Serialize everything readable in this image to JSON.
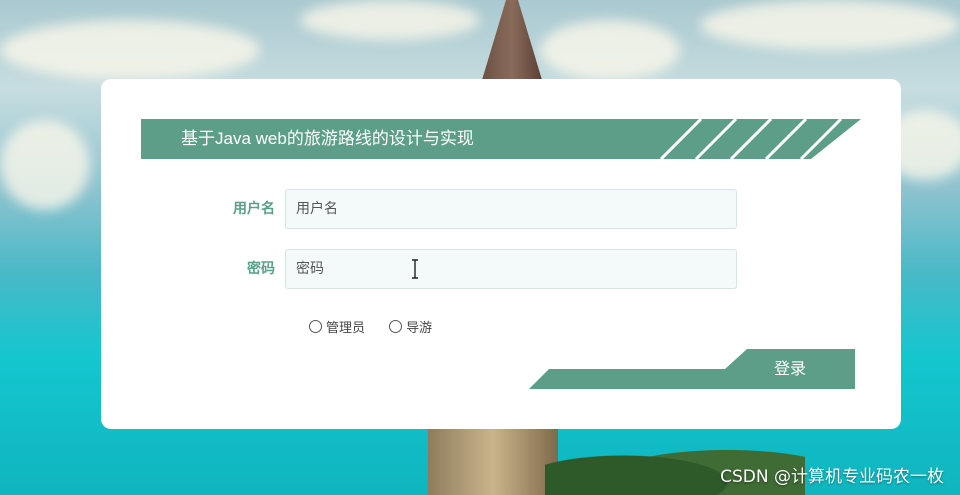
{
  "page": {
    "title": "基于Java web的旅游路线的设计与实现",
    "watermark": "CSDN @计算机专业码农一枚"
  },
  "form": {
    "username": {
      "label": "用户名",
      "placeholder": "用户名",
      "value": ""
    },
    "password": {
      "label": "密码",
      "placeholder": "密码",
      "value": ""
    },
    "roles": [
      {
        "label": "管理员",
        "selected": false
      },
      {
        "label": "导游",
        "selected": false
      }
    ],
    "login_label": "登录"
  },
  "colors": {
    "accent": "#5c9e87",
    "label": "#5b9e89",
    "input_bg": "#f4fafa",
    "card_bg": "#ffffff"
  },
  "icons": {
    "text_cursor": "i-beam-cursor-icon",
    "radio": "radio-circle-icon"
  }
}
